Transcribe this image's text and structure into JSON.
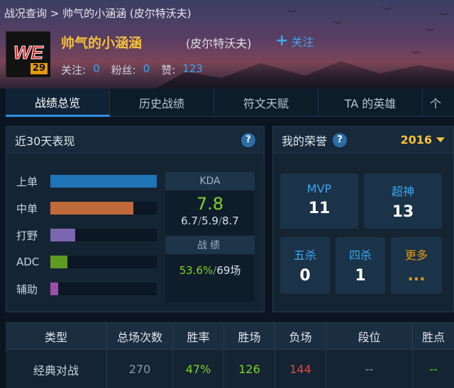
{
  "breadcrumb": "战况查询 > 帅气的小涵涵 (皮尔特沃夫)",
  "profile": {
    "logo_text": "WE",
    "level": "29",
    "name": "帅气的小涵涵",
    "server": "(皮尔特沃夫)",
    "follow_label": "关注",
    "stats": [
      {
        "label": "关注:",
        "value": "0"
      },
      {
        "label": "粉丝:",
        "value": "0"
      },
      {
        "label": "赞:",
        "value": "123"
      }
    ]
  },
  "tabs": [
    "战绩总览",
    "历史战绩",
    "符文天赋",
    "TA 的英雄",
    "个"
  ],
  "recent": {
    "title": "近30天表现",
    "help": "?",
    "roles": [
      {
        "label": "上单",
        "fraction": 1.0,
        "color": "#1f73b7"
      },
      {
        "label": "中单",
        "fraction": 0.78,
        "color": "#c06a3a"
      },
      {
        "label": "打野",
        "fraction": 0.23,
        "color": "#7b66b0"
      },
      {
        "label": "ADC",
        "fraction": 0.16,
        "color": "#5f9a23"
      },
      {
        "label": "辅助",
        "fraction": 0.07,
        "color": "#9b4fa6"
      }
    ],
    "kda_label": "KDA",
    "kda_value": "7.8",
    "kills": "6.7",
    "deaths": "5.9",
    "assists": "8.7",
    "slash": "/",
    "record_label": "战绩",
    "win_rate": "53.6%",
    "games": "69场"
  },
  "honors": {
    "title": "我的荣誉",
    "help": "?",
    "year": "2016",
    "items": [
      {
        "label": "MVP",
        "value": "11"
      },
      {
        "label": "超神",
        "value": "13"
      },
      {
        "label": "五杀",
        "value": "0"
      },
      {
        "label": "四杀",
        "value": "1"
      },
      {
        "label": "更多",
        "value": "..."
      }
    ]
  },
  "table": {
    "headers": [
      "类型",
      "总场次数",
      "胜率",
      "胜场",
      "负场",
      "段位",
      "胜点"
    ],
    "rows": [
      [
        "经典对战",
        "270",
        "47%",
        "126",
        "144",
        "--",
        "--"
      ]
    ]
  },
  "colors": {
    "accent": "#3da6ef",
    "gold": "#f3c13a",
    "green": "#7ed321",
    "red": "#e8443a"
  }
}
